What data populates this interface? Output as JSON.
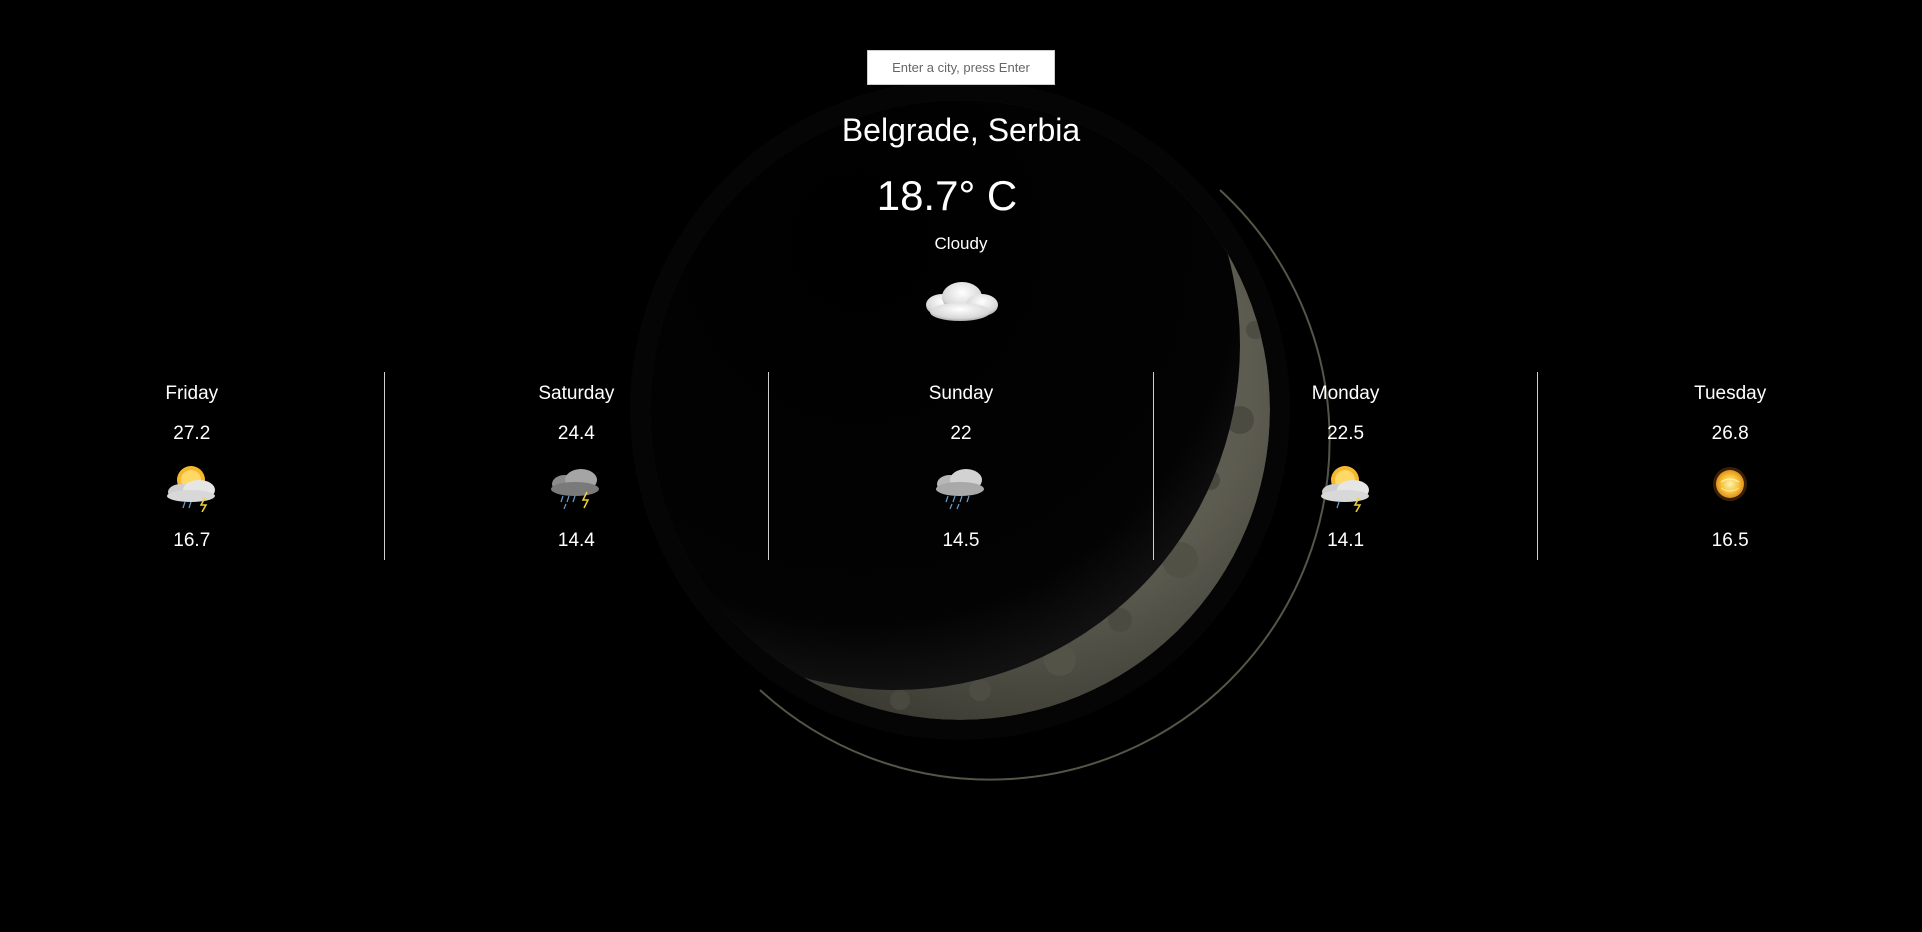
{
  "search": {
    "placeholder": "Enter a city, press Enter",
    "value": ""
  },
  "current": {
    "location": "Belgrade, Serbia",
    "temperature": "18.7° C",
    "condition": "Cloudy",
    "icon": "cloud-icon"
  },
  "forecast": [
    {
      "day": "Friday",
      "high": "27.2",
      "low": "16.7",
      "icon": "sun-cloud-thunder-icon"
    },
    {
      "day": "Saturday",
      "high": "24.4",
      "low": "14.4",
      "icon": "storm-cloud-rain-icon"
    },
    {
      "day": "Sunday",
      "high": "22",
      "low": "14.5",
      "icon": "cloud-rain-icon"
    },
    {
      "day": "Monday",
      "high": "22.5",
      "low": "14.1",
      "icon": "sun-cloud-thunder-icon"
    },
    {
      "day": "Tuesday",
      "high": "26.8",
      "low": "16.5",
      "icon": "sun-icon"
    }
  ],
  "colors": {
    "background": "#000000",
    "text": "#ffffff",
    "divider": "#cfcfcf",
    "moon": "#8a8a7a"
  }
}
